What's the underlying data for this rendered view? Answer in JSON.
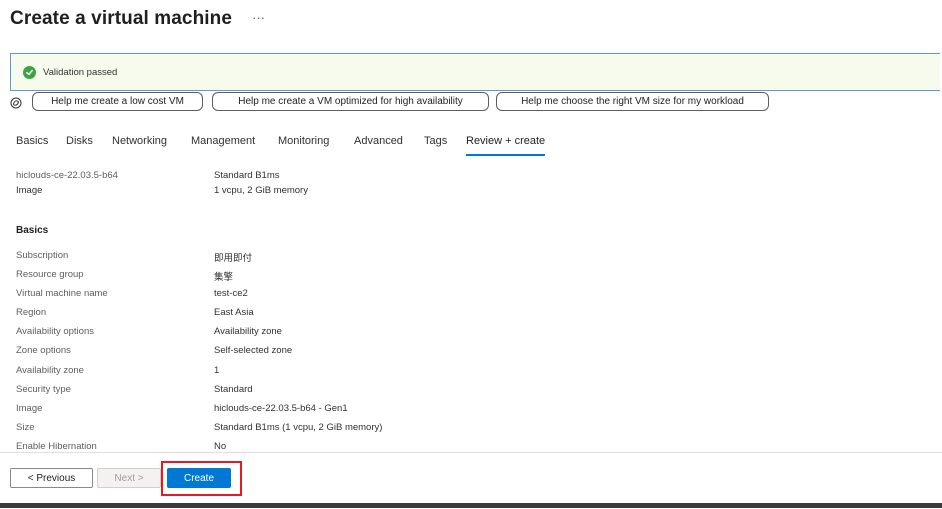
{
  "page": {
    "title": "Create a virtual machine",
    "more": "···"
  },
  "validation": {
    "text": "Validation passed",
    "icon": "check-circle-icon",
    "color": "#3ba543"
  },
  "copilot": {
    "icon": "copilot-icon",
    "suggestions": [
      "Help me create a low cost VM",
      "Help me create a VM optimized for high availability",
      "Help me choose the right VM size for my workload"
    ]
  },
  "tabs": [
    {
      "label": "Basics"
    },
    {
      "label": "Disks"
    },
    {
      "label": "Networking"
    },
    {
      "label": "Management"
    },
    {
      "label": "Monitoring"
    },
    {
      "label": "Advanced"
    },
    {
      "label": "Tags"
    },
    {
      "label": "Review + create",
      "active": true
    }
  ],
  "summary": {
    "image_name": "hiclouds-ce-22.03.5-b64",
    "image_label": "Image",
    "size_name": "Standard B1ms",
    "size_detail": "1 vcpu, 2 GiB memory"
  },
  "basics": {
    "title": "Basics",
    "rows": [
      {
        "label": "Subscription",
        "value": "即用即付"
      },
      {
        "label": "Resource group",
        "value": "集擎"
      },
      {
        "label": "Virtual machine name",
        "value": "test-ce2"
      },
      {
        "label": "Region",
        "value": "East Asia"
      },
      {
        "label": "Availability options",
        "value": "Availability zone"
      },
      {
        "label": "Zone options",
        "value": "Self-selected zone"
      },
      {
        "label": "Availability zone",
        "value": "1"
      },
      {
        "label": "Security type",
        "value": "Standard"
      },
      {
        "label": "Image",
        "value": "hiclouds-ce-22.03.5-b64 - Gen1"
      },
      {
        "label": "Size",
        "value": "Standard B1ms (1 vcpu, 2 GiB memory)"
      },
      {
        "label": "Enable Hibernation",
        "value": "No"
      }
    ]
  },
  "footer": {
    "previous": "< Previous",
    "next": "Next >",
    "create": "Create"
  },
  "colors": {
    "accent": "#0078d4",
    "highlight": "#e31b23"
  }
}
